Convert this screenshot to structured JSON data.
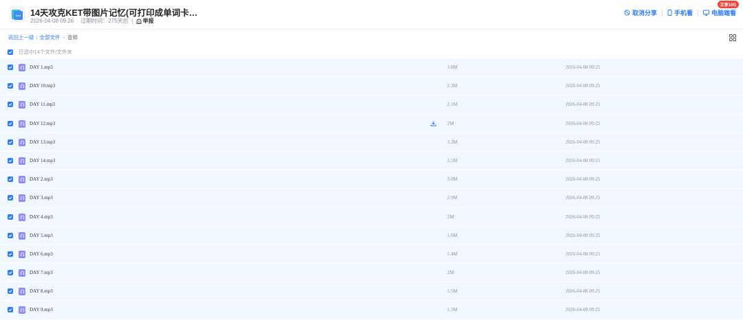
{
  "header": {
    "title": "14天攻克KET带图片记忆(可打印成单词卡…",
    "date": "2026-04-08 09:26",
    "expiry": "过期时间：275天后",
    "report_label": "举报",
    "actions": {
      "cancel_share": "取消分享",
      "mobile": "手机看",
      "pc": "电脑端看",
      "vip_badge": "立享10G"
    }
  },
  "breadcrumb": {
    "back": "返回上一级",
    "root": "全部文件",
    "current": "音频"
  },
  "selection_summary": "已选中14个文件/文件夹",
  "colors": {
    "accent": "#2e7cf6",
    "row_bg": "#f2f8ff",
    "audio_icon": "#8f8ef7",
    "badge": "#f0453b"
  },
  "files": [
    {
      "name": "DAY 1.mp3",
      "size": "3.8M",
      "date": "2026-04-08 09:25"
    },
    {
      "name": "DAY 10.mp3",
      "size": "2.3M",
      "date": "2026-04-08 09:25"
    },
    {
      "name": "DAY 11.mp3",
      "size": "2.1M",
      "date": "2026-04-08 09:25"
    },
    {
      "name": "DAY 12.mp3",
      "size": "2M",
      "date": "2026-04-08 09:25"
    },
    {
      "name": "DAY 13.mp3",
      "size": "3.3M",
      "date": "2026-04-08 09:25"
    },
    {
      "name": "DAY 14.mp3",
      "size": "2.5M",
      "date": "2026-04-08 09:25"
    },
    {
      "name": "DAY 2.mp3",
      "size": "3.8M",
      "date": "2026-04-08 09:25"
    },
    {
      "name": "DAY 3.mp3",
      "size": "2.9M",
      "date": "2026-04-08 09:25"
    },
    {
      "name": "DAY 4.mp3",
      "size": "2M",
      "date": "2026-04-08 09:25"
    },
    {
      "name": "DAY 5.mp3",
      "size": "1.6M",
      "date": "2026-04-08 09:25"
    },
    {
      "name": "DAY 6.mp3",
      "size": "1.4M",
      "date": "2026-04-08 09:25"
    },
    {
      "name": "DAY 7.mp3",
      "size": "2M",
      "date": "2026-04-08 09:25"
    },
    {
      "name": "DAY 8.mp3",
      "size": "1.5M",
      "date": "2026-04-08 09:25"
    },
    {
      "name": "DAY 9.mp3",
      "size": "1.5M",
      "date": "2026-04-08 09:25"
    }
  ]
}
